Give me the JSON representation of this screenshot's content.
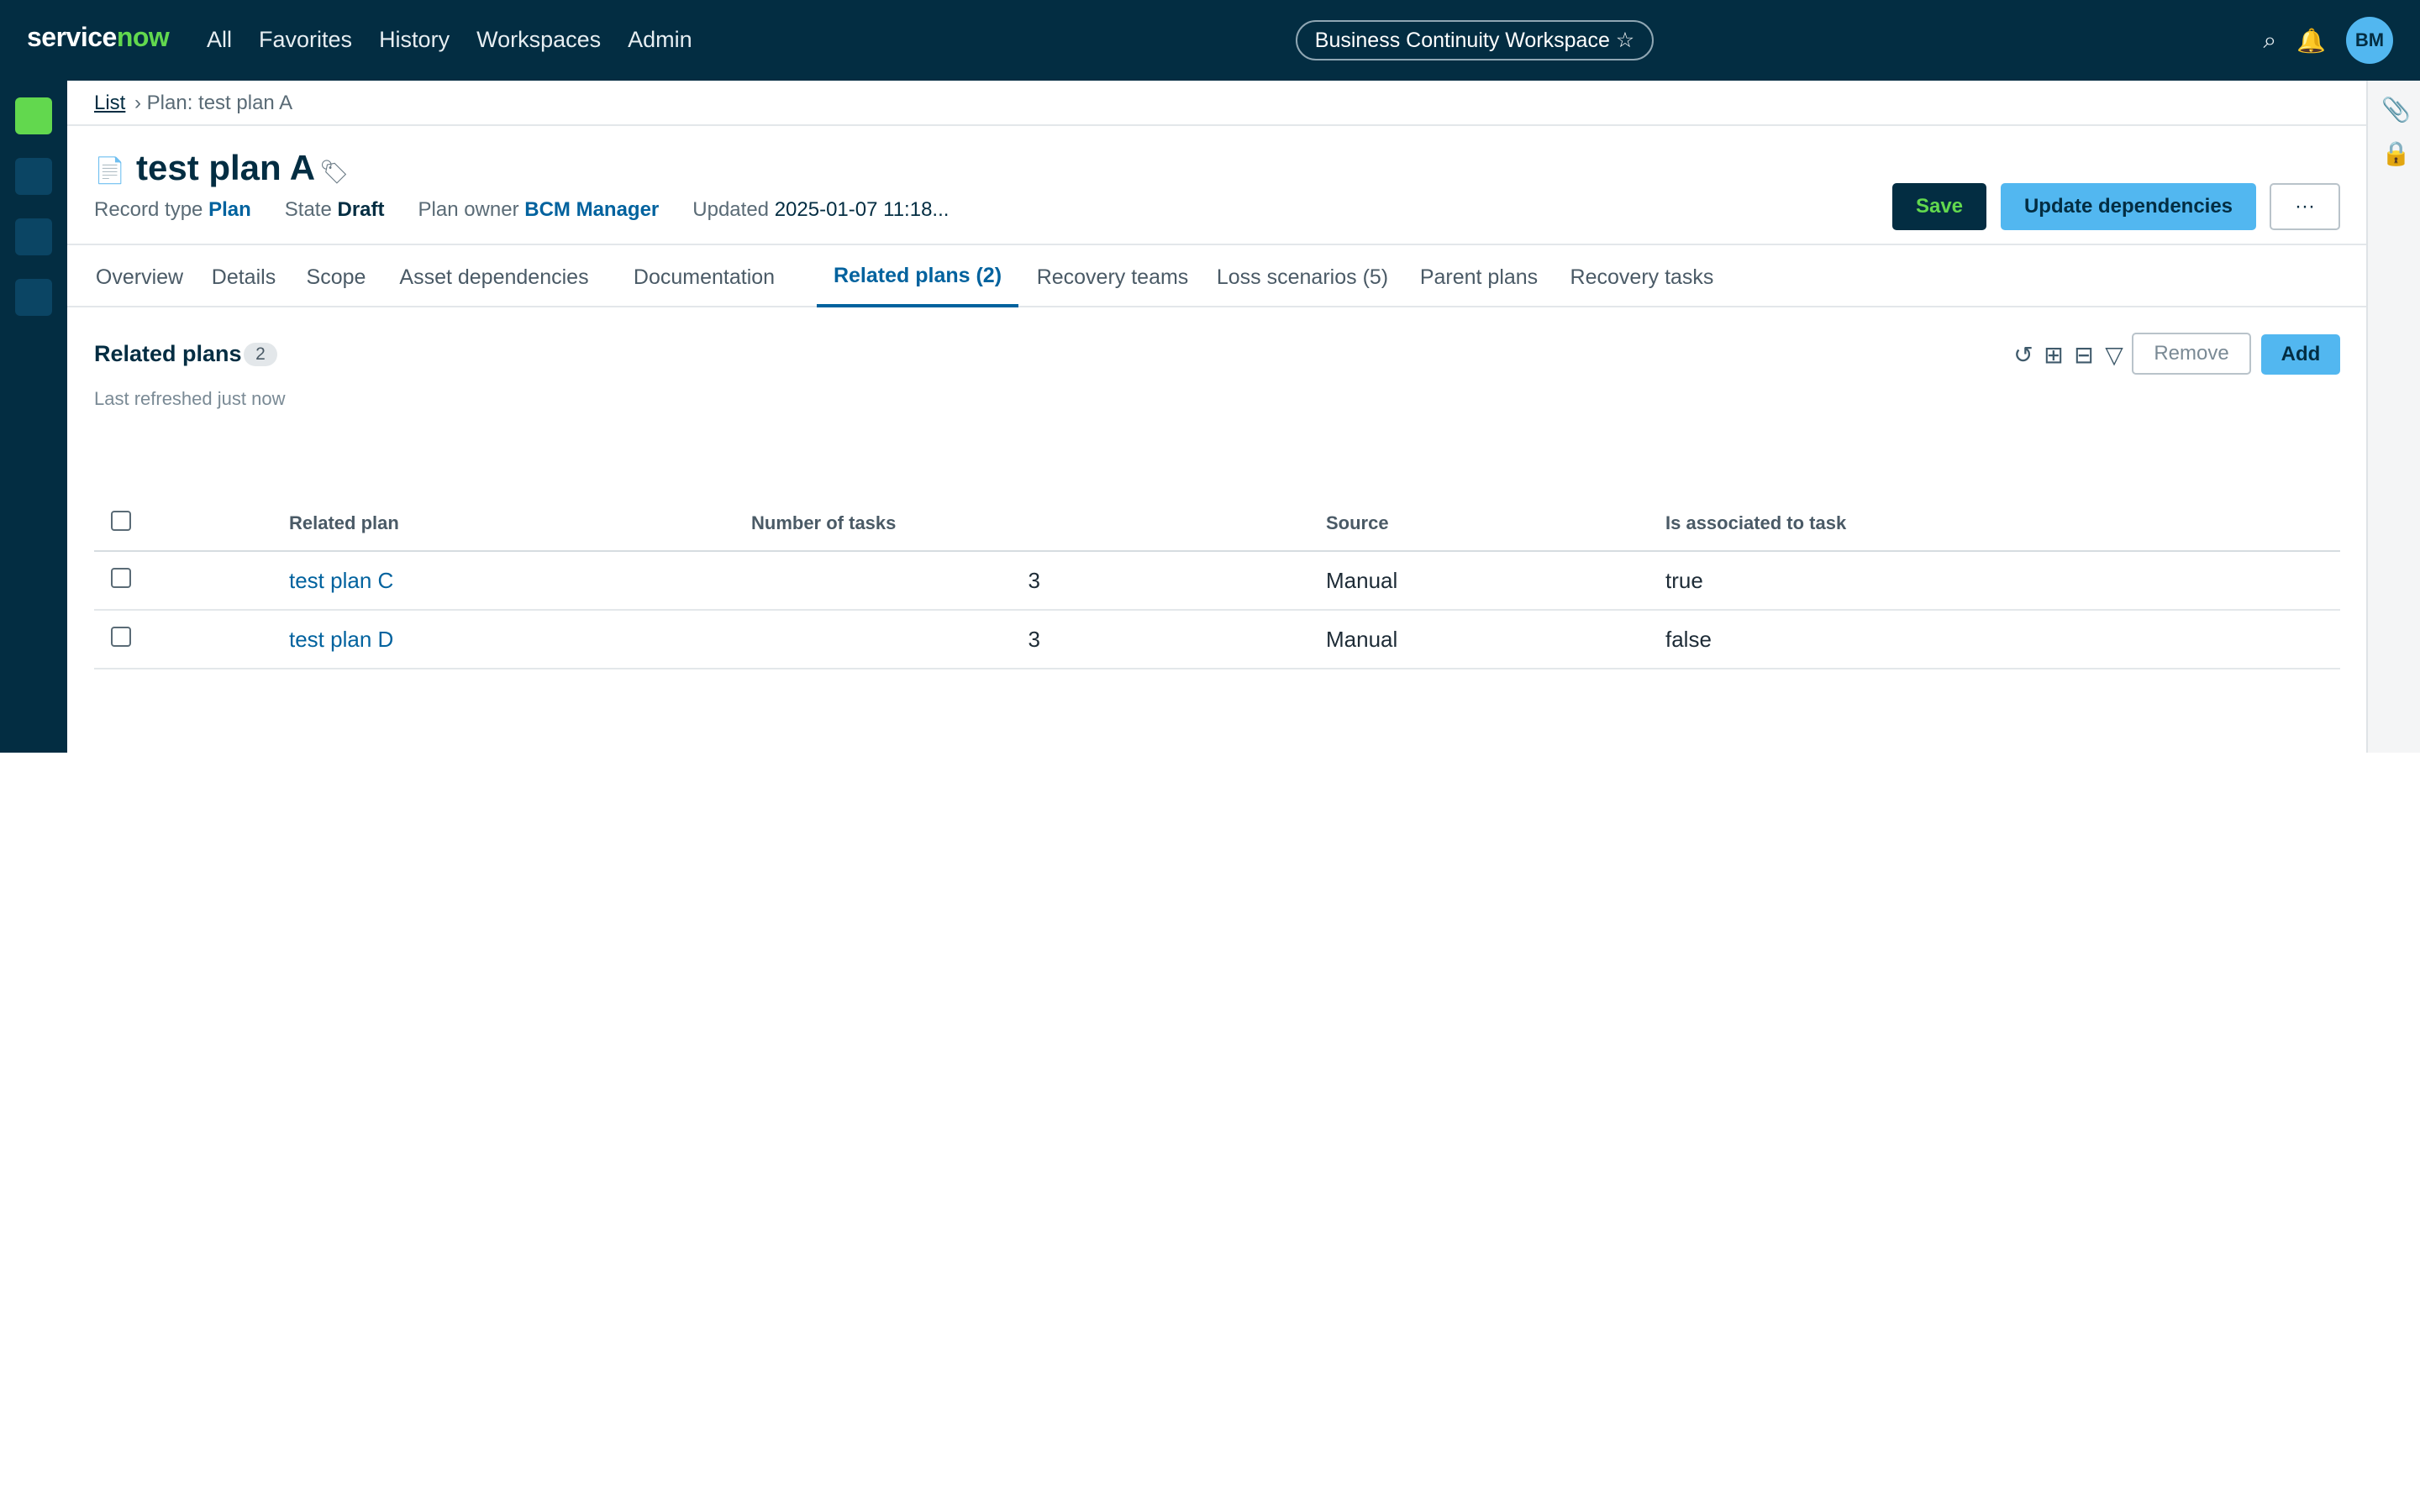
{
  "header": {
    "logo_service": "service",
    "logo_now": "now",
    "nav": [
      "All",
      "Favorites",
      "History",
      "Workspaces",
      "Admin"
    ],
    "workspace": "Business Continuity Workspace ☆",
    "avatar_initials": "BM",
    "icons": [
      "search-icon",
      "bell-icon"
    ]
  },
  "breadcrumb": {
    "list": "List",
    "current": "› Plan: test plan A"
  },
  "record": {
    "title": "test plan A",
    "meta": {
      "record_type_label": "Record type",
      "record_type": "Plan",
      "state_label": "State",
      "state": "Draft",
      "owner_label": "Plan owner",
      "owner": "BCM Manager",
      "updated_label": "Updated",
      "updated": "2025-01-07 11:18..."
    }
  },
  "actions": {
    "save": "Save",
    "update": "Update dependencies",
    "more": "···"
  },
  "tabs": [
    {
      "label": "Overview"
    },
    {
      "label": "Details"
    },
    {
      "label": "Scope"
    },
    {
      "label": "Asset dependencies"
    },
    {
      "label": "Documentation"
    },
    {
      "label": "Related plans (2)",
      "active": true
    },
    {
      "label": "Recovery teams"
    },
    {
      "label": "Loss scenarios (5)"
    },
    {
      "label": "Parent plans"
    },
    {
      "label": "Recovery tasks"
    }
  ],
  "related": {
    "title": "Related plans",
    "count": "2",
    "refreshed": "Last refreshed just now",
    "remove": "Remove",
    "add": "Add",
    "columns": [
      "Related plan",
      "Number of tasks",
      "Source",
      "Is associated to task"
    ],
    "rows": [
      {
        "plan": "test plan C",
        "tasks": "3",
        "source": "Manual",
        "associated": "true"
      },
      {
        "plan": "test plan D",
        "tasks": "3",
        "source": "Manual",
        "associated": "false"
      }
    ]
  },
  "colors": {
    "nav_bg": "#032d42",
    "accent_green": "#62d84e",
    "accent_blue": "#52b7f0",
    "link": "#00629e"
  }
}
